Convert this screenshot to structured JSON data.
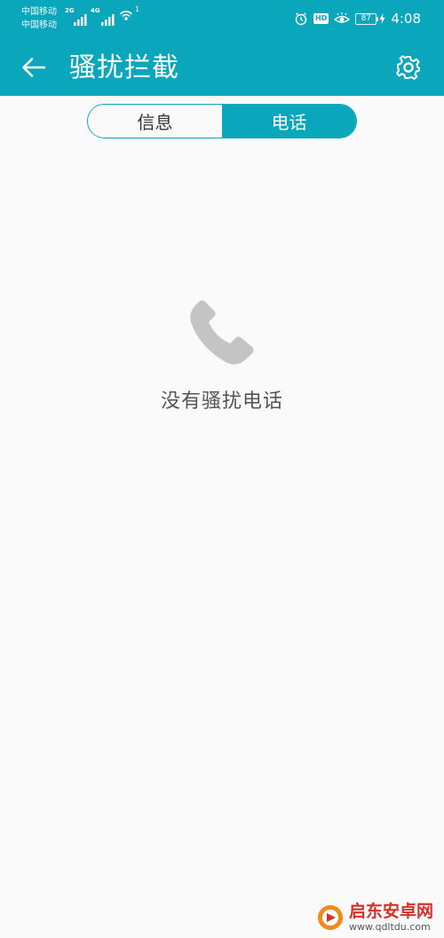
{
  "status_bar": {
    "carrier_1": "中国移动",
    "carrier_2": "中国移动",
    "signal_1_label": "2G",
    "signal_2_label": "4G",
    "wifi_badge": "1",
    "hd_label": "HD",
    "battery_level": "87",
    "time": "4:08"
  },
  "app_bar": {
    "title": "骚扰拦截",
    "back_icon": "arrow-left-icon",
    "settings_icon": "gear-icon"
  },
  "tabs": [
    {
      "label": "信息",
      "active": false
    },
    {
      "label": "电话",
      "active": true
    }
  ],
  "empty_state": {
    "icon": "phone-icon",
    "message": "没有骚扰电话"
  },
  "watermark": {
    "brand": "启东安卓网",
    "url": "www.qdltdu.com"
  },
  "colors": {
    "primary": "#0aa6bb",
    "background": "#fafafa",
    "icon_gray": "#c4c4c4",
    "text_gray": "#555555"
  }
}
